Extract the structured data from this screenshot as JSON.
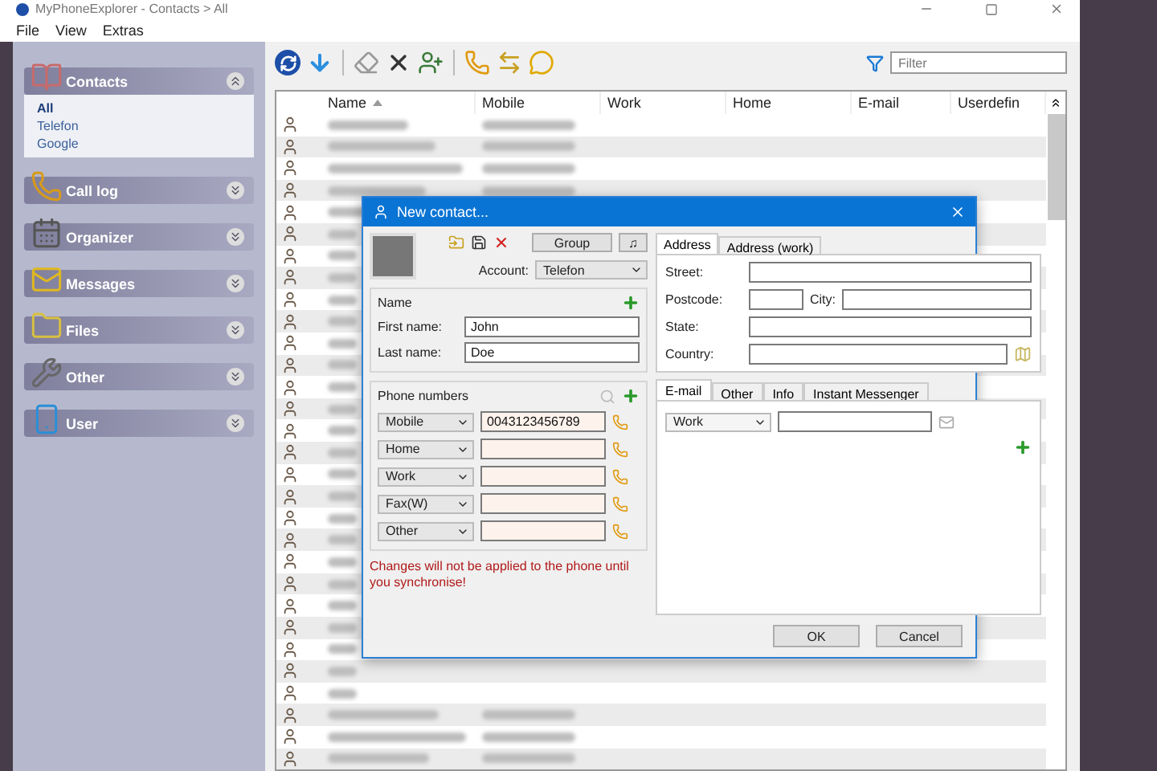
{
  "window": {
    "title": "MyPhoneExplorer -  Contacts > All"
  },
  "menu": [
    "File",
    "View",
    "Extras"
  ],
  "sidebar": {
    "sections": [
      {
        "kind": "contacts",
        "label": "Contacts",
        "expanded": true,
        "items": [
          {
            "label": "All",
            "selected": true
          },
          {
            "label": "Telefon",
            "selected": false
          },
          {
            "label": "Google",
            "selected": false
          }
        ]
      },
      {
        "kind": "calllog",
        "label": "Call log",
        "expanded": false
      },
      {
        "kind": "organizer",
        "label": "Organizer",
        "expanded": false
      },
      {
        "kind": "messages",
        "label": "Messages",
        "expanded": false
      },
      {
        "kind": "files",
        "label": "Files",
        "expanded": false
      },
      {
        "kind": "other",
        "label": "Other",
        "expanded": false
      },
      {
        "kind": "user",
        "label": "User",
        "expanded": false
      }
    ]
  },
  "filter": {
    "placeholder": "Filter"
  },
  "table": {
    "columns": [
      {
        "label": "Name",
        "sorted": true
      },
      {
        "label": "Mobile",
        "sorted": false
      },
      {
        "label": "Work",
        "sorted": false
      },
      {
        "label": "Home",
        "sorted": false
      },
      {
        "label": "E-mail",
        "sorted": false
      },
      {
        "label": "Userdefin",
        "sorted": false
      }
    ]
  },
  "dialog": {
    "title": "New contact...",
    "group_button": "Group",
    "note_button": "♫",
    "account_label": "Account:",
    "account": "Telefon",
    "name_section": "Name",
    "first_name_label": "First name:",
    "first_name": "John",
    "last_name_label": "Last name:",
    "last_name": "Doe",
    "phone_section": "Phone numbers",
    "phones": [
      {
        "type": "Mobile",
        "value": "0043123456789"
      },
      {
        "type": "Home"
      },
      {
        "type": "Work"
      },
      {
        "type": "Fax(W)"
      },
      {
        "type": "Other"
      }
    ],
    "warning": "Changes will not be applied to the phone until you synchronise!",
    "address_tabs": [
      {
        "label": "Address",
        "selected": true
      },
      {
        "label": "Address (work)",
        "selected": false
      }
    ],
    "address_rows": [
      {
        "kind": "single",
        "label": "Street:"
      },
      {
        "kind": "pair",
        "label": "Postcode:",
        "label2": "City:"
      },
      {
        "kind": "single",
        "label": "State:"
      },
      {
        "kind": "picker",
        "label": "Country:"
      }
    ],
    "contact_tabs": [
      {
        "label": "E-mail",
        "selected": true
      },
      {
        "label": "Other",
        "selected": false
      },
      {
        "label": "Info",
        "selected": false
      },
      {
        "label": "Instant Messenger",
        "selected": false
      }
    ],
    "email_type": "Work",
    "ok": "OK",
    "cancel": "Cancel"
  }
}
